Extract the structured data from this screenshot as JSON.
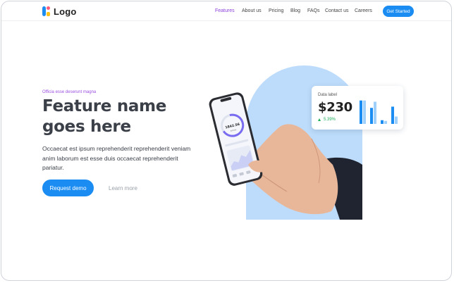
{
  "header": {
    "logo_text": "Logo",
    "nav": [
      {
        "label": "Features",
        "active": true
      },
      {
        "label": "About us",
        "active": false
      },
      {
        "label": "Pricing",
        "active": false
      },
      {
        "label": "Blog",
        "active": false
      },
      {
        "label": "FAQs",
        "active": false
      },
      {
        "label": "Contact us",
        "active": false
      },
      {
        "label": "Careers",
        "active": false
      }
    ],
    "cta_label": "Get Started"
  },
  "hero": {
    "eyebrow": "Officia esse deserunt magna",
    "title": "Feature name goes here",
    "description": "Occaecat est ipsum reprehenderit reprehenderit veniam anim laborum est esse duis occaecat reprehenderit pariatur.",
    "primary_button": "Request demo",
    "secondary_link": "Learn more"
  },
  "card": {
    "label": "Data label",
    "value": "$230",
    "change": "5.39%",
    "change_direction": "up",
    "bars": [
      {
        "dark": 0.95,
        "light": 0.95
      },
      {
        "dark": 0.65,
        "light": 0.9
      },
      {
        "dark": 0.15,
        "light": 0.12
      },
      {
        "dark": 0.7,
        "light": 0.3
      }
    ]
  },
  "phone": {
    "screen_value": "1842.56",
    "screen_label": "EATRAL"
  },
  "colors": {
    "accent": "#1a8cf2",
    "eyebrow": "#9b4fe0",
    "nav_active": "#8b3fd9",
    "arch": "#bddcfb",
    "positive": "#1eae5a"
  }
}
